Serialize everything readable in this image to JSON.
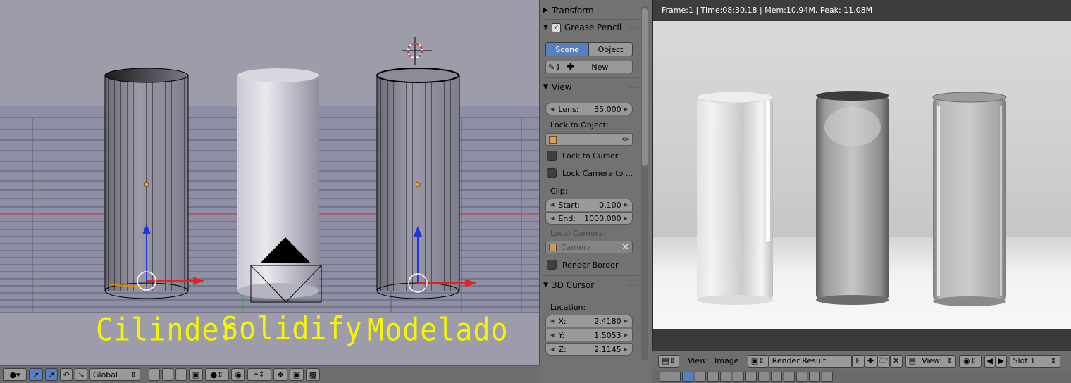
{
  "viewport": {
    "object_labels": [
      "Cilinder",
      "Solidify",
      "Modelado"
    ],
    "header": {
      "orientation": "Global"
    }
  },
  "properties": {
    "transform": "Transform",
    "grease_pencil": {
      "title": "Grease Pencil",
      "tabs": [
        "Scene",
        "Object"
      ],
      "active_tab": "Scene",
      "new_label": "New"
    },
    "view": {
      "title": "View",
      "lens_label": "Lens:",
      "lens_value": "35.000",
      "lock_to_object": "Lock to Object:",
      "lock_to_cursor": "Lock to Cursor",
      "lock_camera": "Lock Camera to ...",
      "clip": "Clip:",
      "start_label": "Start:",
      "start_value": "0.100",
      "end_label": "End:",
      "end_value": "1000.000",
      "local_camera": "Local Camera:",
      "camera_placeholder": "Camera",
      "render_border": "Render Border"
    },
    "cursor": {
      "title": "3D Cursor",
      "location": "Location:",
      "x_label": "X:",
      "x_value": "2.4180",
      "y_label": "Y:",
      "y_value": "1.5053",
      "z_label": "Z:",
      "z_value": "2.1145"
    }
  },
  "render": {
    "info": "Frame:1 | Time:08:30.18 | Mem:10.94M, Peak: 11.08M",
    "menu": [
      "View",
      "Image"
    ],
    "image_name": "Render Result",
    "fake_user": "F",
    "view_label": "View",
    "slot_label": "Slot 1"
  },
  "colors": {
    "accent": "#5680c2",
    "label_yellow": "#f5f500",
    "axis_red": "#e32222",
    "axis_blue": "#2233dd"
  }
}
